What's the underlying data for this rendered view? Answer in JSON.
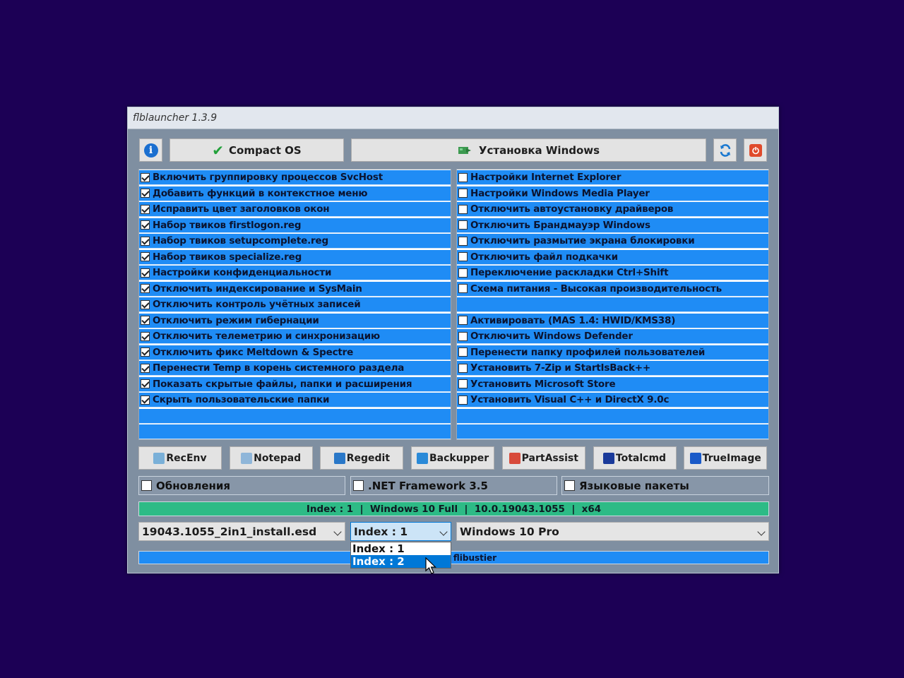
{
  "window": {
    "title": "flblauncher 1.3.9"
  },
  "toolbar": {
    "info_icon": "info-icon",
    "compact_label": "Compact OS",
    "install_label": "Установка Windows",
    "refresh_icon": "refresh-icon",
    "power_icon": "power-icon"
  },
  "left_options": [
    {
      "label": "Включить группировку процессов SvcHost",
      "checked": true
    },
    {
      "label": "Добавить функций в контекстное меню",
      "checked": true
    },
    {
      "label": "Исправить цвет заголовков окон",
      "checked": true
    },
    {
      "label": "Набор твиков firstlogon.reg",
      "checked": true
    },
    {
      "label": "Набор твиков setupcomplete.reg",
      "checked": true
    },
    {
      "label": "Набор твиков specialize.reg",
      "checked": true
    },
    {
      "label": "Настройки конфиденциальности",
      "checked": true
    },
    {
      "label": "Отключить индексирование и SysMain",
      "checked": true
    },
    {
      "label": "Отключить контроль учётных записей",
      "checked": true
    },
    {
      "label": "Отключить режим гибернации",
      "checked": true
    },
    {
      "label": "Отключить телеметрию и синхронизацию",
      "checked": true
    },
    {
      "label": "Отключить фикс Meltdown & Spectre",
      "checked": true
    },
    {
      "label": "Перенести Temp в корень системного раздела",
      "checked": true
    },
    {
      "label": "Показать скрытые файлы, папки и расширения",
      "checked": true
    },
    {
      "label": "Скрыть пользовательские папки",
      "checked": true
    }
  ],
  "right_options": [
    {
      "label": "Настройки Internet Explorer",
      "checked": false
    },
    {
      "label": "Настройки Windows Media Player",
      "checked": false
    },
    {
      "label": "Отключить автоустановку драйверов",
      "checked": false
    },
    {
      "label": "Отключить Брандмауэр Windows",
      "checked": false
    },
    {
      "label": "Отключить размытие экрана блокировки",
      "checked": false
    },
    {
      "label": "Отключить файл подкачки",
      "checked": false
    },
    {
      "label": "Переключение раскладки Ctrl+Shift",
      "checked": false
    },
    {
      "label": "Схема питания - Высокая производительность",
      "checked": false
    },
    {
      "label": "",
      "checked": null
    },
    {
      "label": "Активировать (MAS 1.4: HWID/KMS38)",
      "checked": false
    },
    {
      "label": "Отключить Windows Defender",
      "checked": false
    },
    {
      "label": "Перенести папку профилей пользователей",
      "checked": false
    },
    {
      "label": "Установить 7-Zip и StartIsBack++",
      "checked": false
    },
    {
      "label": "Установить Microsoft Store",
      "checked": false
    },
    {
      "label": "Установить Visual C++ и DirectX 9.0c",
      "checked": false
    }
  ],
  "tools": [
    {
      "label": "RecEnv",
      "icon": "recenv-icon",
      "color": "#7ab0d8"
    },
    {
      "label": "Notepad",
      "icon": "notepad-icon",
      "color": "#8fb6d9"
    },
    {
      "label": "Regedit",
      "icon": "regedit-icon",
      "color": "#2a78c8"
    },
    {
      "label": "Backupper",
      "icon": "backupper-icon",
      "color": "#2a8ad8"
    },
    {
      "label": "PartAssist",
      "icon": "partassist-icon",
      "color": "#d84a3a"
    },
    {
      "label": "Totalcmd",
      "icon": "totalcmd-icon",
      "color": "#1a3a9a"
    },
    {
      "label": "TrueImage",
      "icon": "trueimage-icon",
      "color": "#1a5ac8"
    }
  ],
  "extras": {
    "updates": "Обновления",
    "netfx": ".NET Framework 3.5",
    "langpacks": "Языковые пакеты"
  },
  "status": "Index : 1  |  Windows 10 Full  |  10.0.19043.1055  |  x64",
  "selectors": {
    "image_file": "19043.1055_2in1_install.esd",
    "index": "Index : 1",
    "edition": "Windows 10 Pro"
  },
  "index_dropdown": [
    "Index : 1",
    "Index : 2"
  ],
  "progress_text": "flibustier",
  "colors": {
    "desktop": "#1c0055",
    "row_blue": "#1f8cf5",
    "status_green": "#2dbb86",
    "window_gray": "#7f8fa1"
  }
}
